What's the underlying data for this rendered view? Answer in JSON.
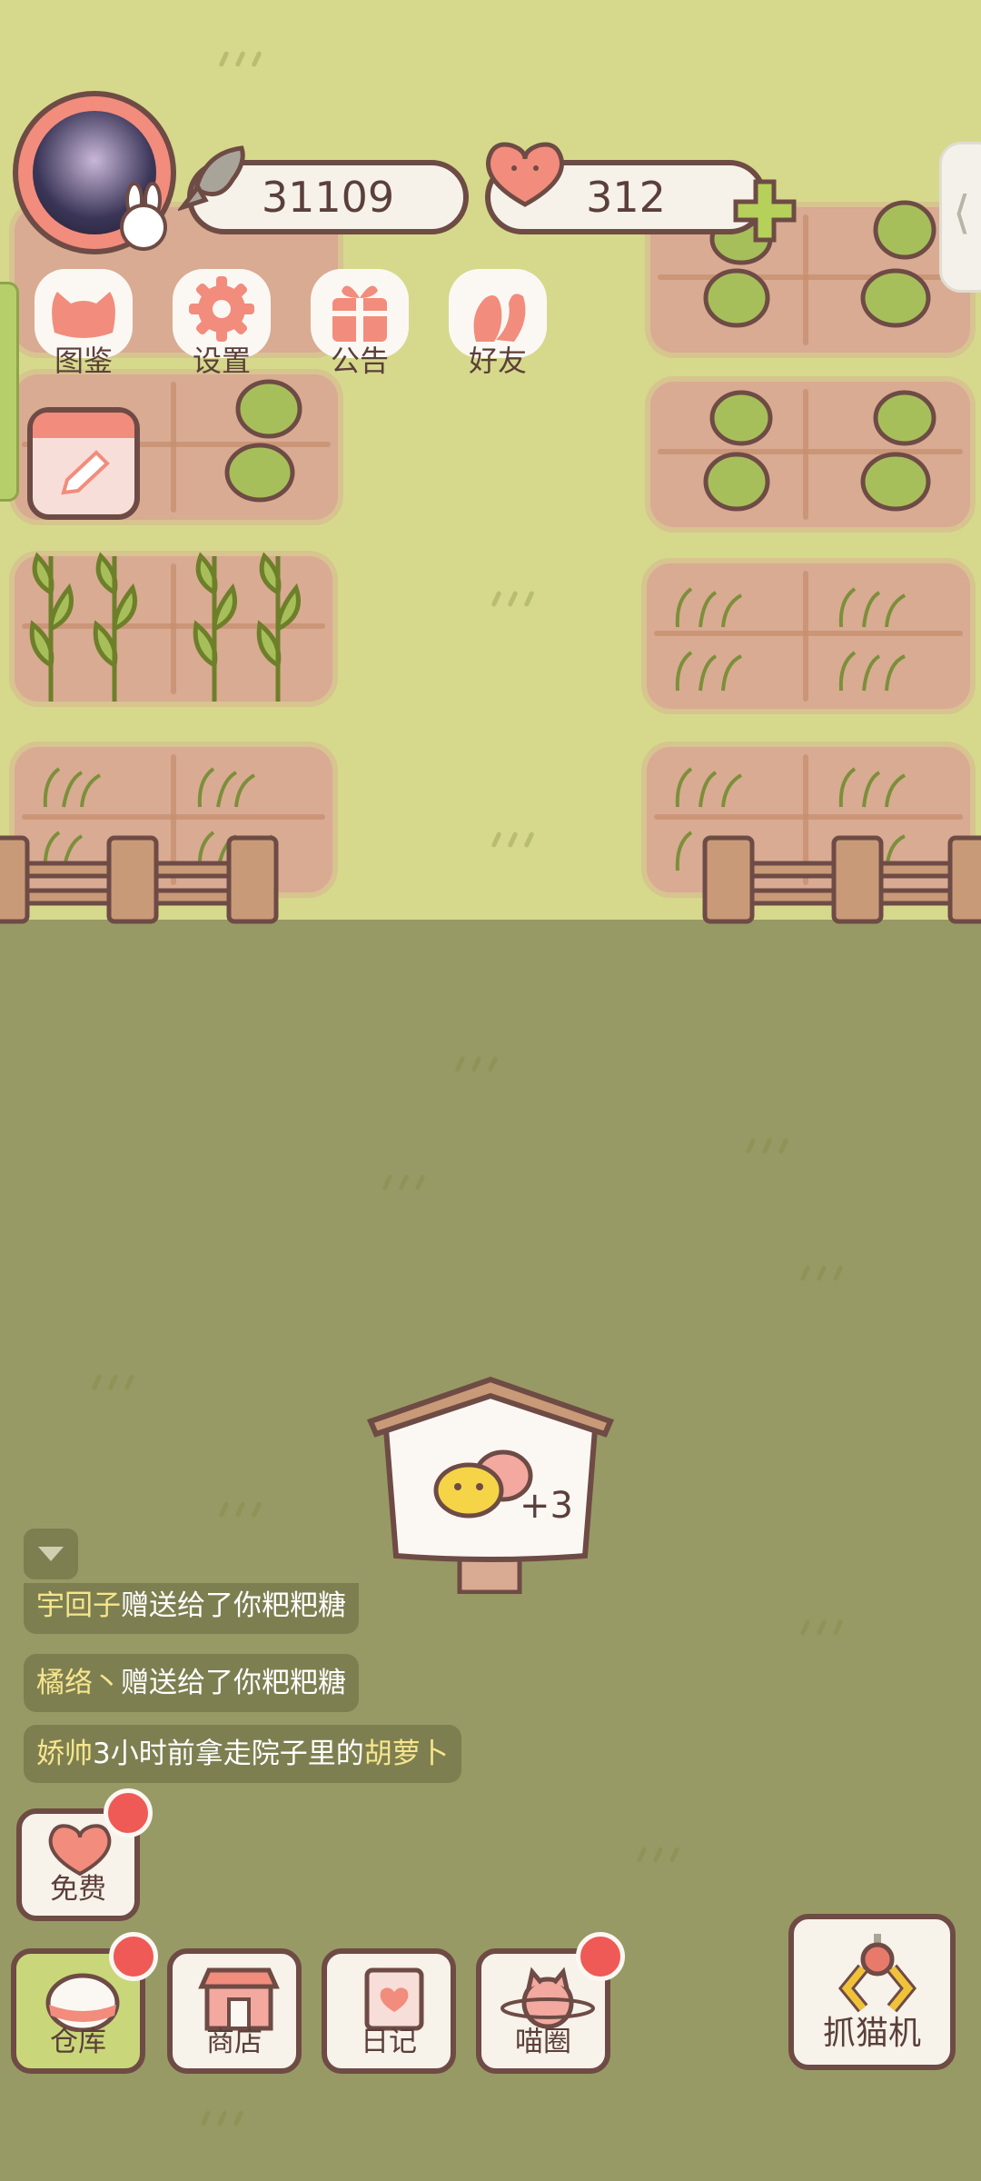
{
  "resources": {
    "fish_count": "31109",
    "heart_count": "312"
  },
  "menu": [
    {
      "label": "图鉴",
      "icon": "cat-head-icon"
    },
    {
      "label": "设置",
      "icon": "gear-icon"
    },
    {
      "label": "公告",
      "icon": "gift-icon"
    },
    {
      "label": "好友",
      "icon": "friends-icon"
    }
  ],
  "cat_house": {
    "plus_label": "+3"
  },
  "chat": [
    {
      "name": "宇回子",
      "text": "赠送给了你粑粑糖"
    },
    {
      "name": "橘络丶",
      "text": "赠送给了你粑粑糖"
    },
    {
      "pre": "娇帅",
      "text": "3小时前拿走院子里的",
      "item": "胡萝卜"
    }
  ],
  "buttons": {
    "free": "免费",
    "warehouse": "仓库",
    "shop": "商店",
    "diary": "日记",
    "cat_circle": "喵圈",
    "claw_machine": "抓猫机"
  },
  "colors": {
    "upper_field": "#d6d98c",
    "lower_field": "#979a64",
    "outline": "#6e4b45",
    "accent_pink": "#f28c7c",
    "badge_red": "#ef5a56"
  }
}
